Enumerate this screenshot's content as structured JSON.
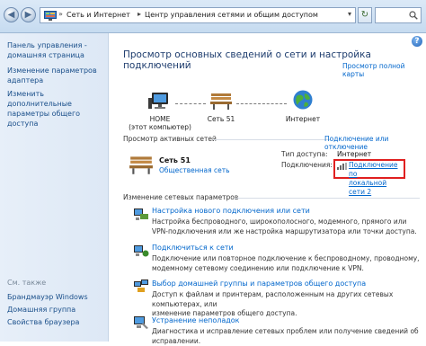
{
  "address_bar": {
    "crumbs": [
      "Сеть и Интернет",
      "Центр управления сетями и общим доступом"
    ],
    "search_placeholder": ""
  },
  "left_pane": {
    "links": [
      "Панель управления -",
      "домашняя страница",
      "Изменение параметров",
      "адаптера",
      "Изменить дополнительные",
      "параметры общего доступа"
    ],
    "see_also_heading": "См. также",
    "see_also": [
      "Брандмауэр Windows",
      "Домашняя группа",
      "Свойства браузера"
    ]
  },
  "main": {
    "title": "Просмотр основных сведений о сети и настройка подключений",
    "full_map_link": "Просмотр полной карты",
    "map": {
      "nodes": [
        {
          "line1": "HOME",
          "line2": "(этот компьютер)"
        },
        {
          "line1": "Сеть  51",
          "line2": ""
        },
        {
          "line1": "Интернет",
          "line2": ""
        }
      ]
    },
    "active_networks_label": "Просмотр активных сетей",
    "connect_disconnect_link": "Подключение или отключение",
    "network": {
      "name": "Сеть  51",
      "type": "Общественная сеть",
      "access_type_label": "Тип доступа:",
      "access_type_value": "Интернет",
      "connections_label": "Подключения:",
      "connection_line1": "Подключение по",
      "connection_line2": "локальной сети 2"
    },
    "change_settings_label": "Изменение сетевых параметров",
    "tasks": [
      {
        "title": "Настройка нового подключения или сети",
        "desc1": "Настройка беспроводного, широкополосного, модемного, прямого или",
        "desc2": "VPN-подключения или же настройка маршрутизатора или точки доступа."
      },
      {
        "title": "Подключиться к сети",
        "desc1": "Подключение или повторное подключение к беспроводному, проводному,",
        "desc2": "модемному сетевому соединению или подключение к VPN."
      },
      {
        "title": "Выбор домашней группы и параметров общего доступа",
        "desc1": "Доступ к файлам и принтерам, расположенным на других сетевых компьютерах, или",
        "desc2": "изменение параметров общего доступа."
      },
      {
        "title": "Устранение неполадок",
        "desc1": "Диагностика и исправление сетевых проблем или получение сведений об",
        "desc2": "исправлении."
      }
    ]
  },
  "colors": {
    "link": "#0066cc",
    "title": "#1e3d6e",
    "highlight_box": "#e02020",
    "left_pane_bg": "#e3ecf7"
  }
}
